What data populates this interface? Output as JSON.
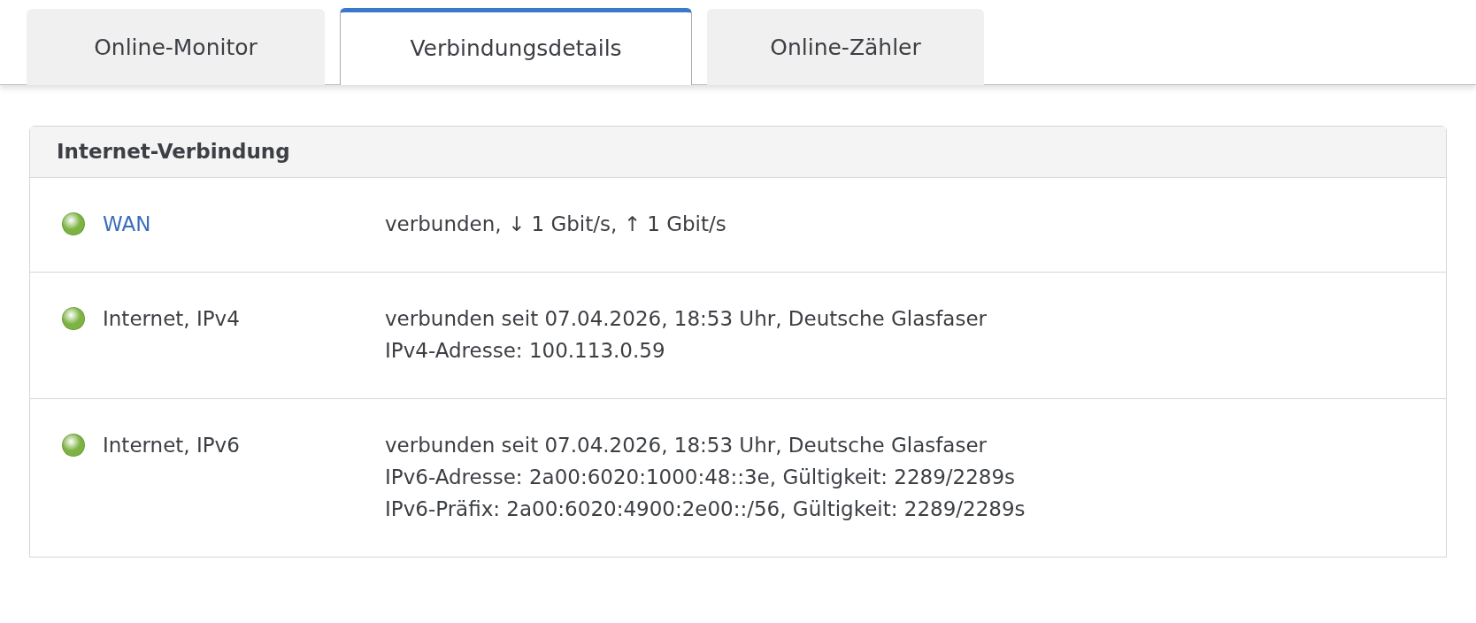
{
  "tabs": [
    {
      "label": "Online-Monitor",
      "selected": false
    },
    {
      "label": "Verbindungsdetails",
      "selected": true
    },
    {
      "label": "Online-Zähler",
      "selected": false
    }
  ],
  "panel": {
    "title": "Internet-Verbindung",
    "rows": [
      {
        "name": "WAN",
        "kind": "link",
        "color": "#7cb342",
        "lines": [
          "verbunden, ↓ 1 Gbit/s, ↑ 1 Gbit/s"
        ]
      },
      {
        "name": "Internet, IPv4",
        "kind": "text",
        "color": "#7cb342",
        "lines": [
          "verbunden seit 07.04.2026, 18:53 Uhr, Deutsche Glasfaser",
          "IPv4-Adresse: 100.113.0.59"
        ]
      },
      {
        "name": "Internet, IPv6",
        "kind": "text",
        "color": "#7cb342",
        "lines": [
          "verbunden seit 07.04.2026, 18:53 Uhr, Deutsche Glasfaser",
          "IPv6-Adresse: 2a00:6020:1000:48::3e, Gültigkeit: 2289/2289s",
          "IPv6-Präfix: 2a00:6020:4900:2e00::/56, Gültigkeit: 2289/2289s"
        ]
      }
    ]
  }
}
